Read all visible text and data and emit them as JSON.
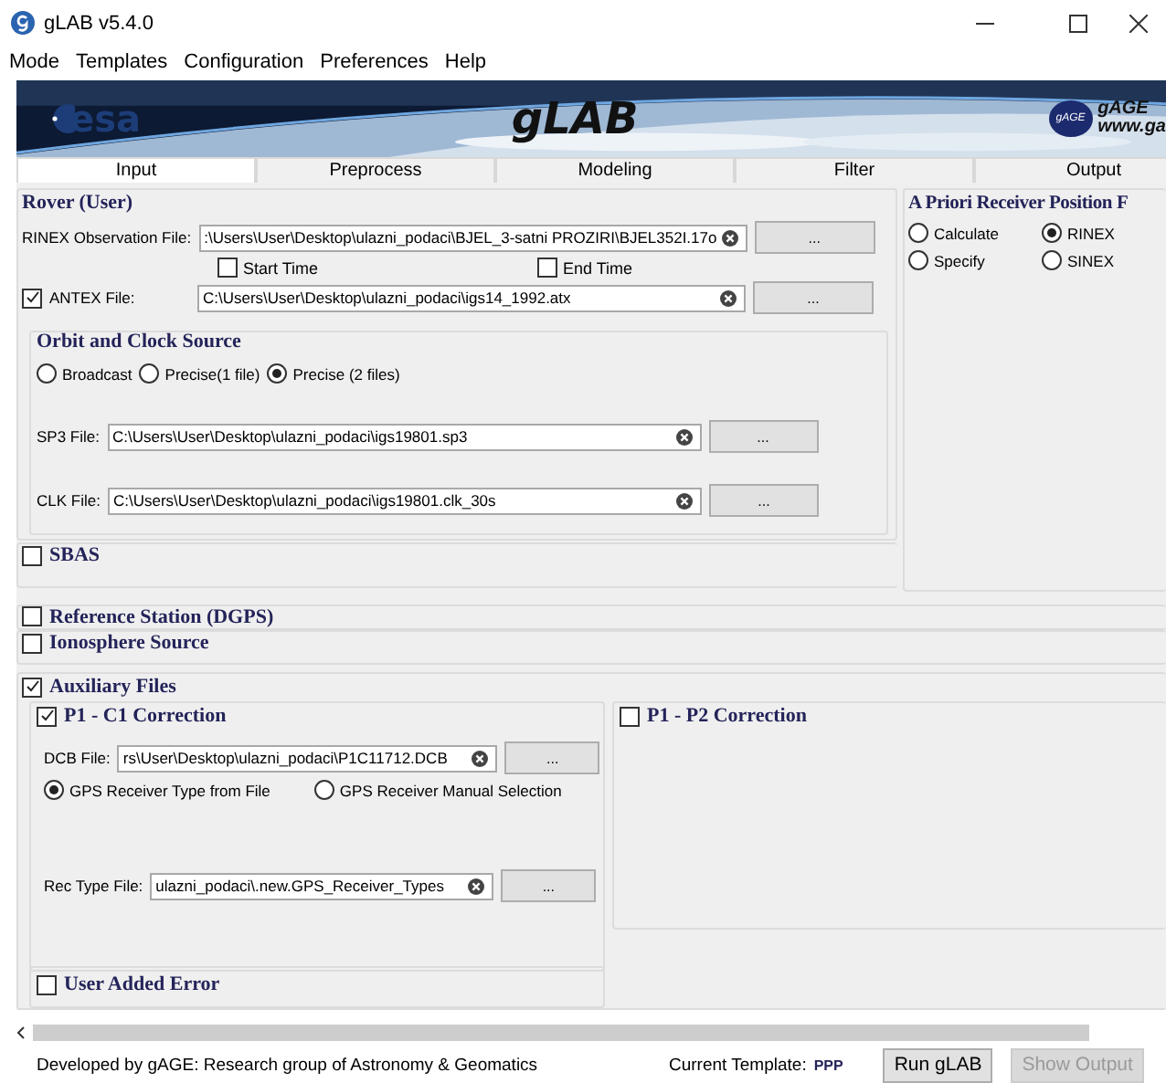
{
  "window": {
    "title": "gLAB v5.4.0"
  },
  "menu": [
    "Mode",
    "Templates",
    "Configuration",
    "Preferences",
    "Help"
  ],
  "banner": {
    "left_logo": "esa",
    "title": "gLAB",
    "right_badge": "gAGE",
    "right_title": "gAGE",
    "right_url": "www.ga"
  },
  "tabs": [
    {
      "label": "Input",
      "selected": true
    },
    {
      "label": "Preprocess",
      "selected": false
    },
    {
      "label": "Modeling",
      "selected": false
    },
    {
      "label": "Filter",
      "selected": false
    },
    {
      "label": "Output",
      "selected": false
    }
  ],
  "rover": {
    "title": "Rover (User)",
    "rinex": {
      "label": "RINEX Observation File:",
      "value": ":\\Users\\User\\Desktop\\ulazni_podaci\\BJEL_3-satni PROZIRI\\BJEL352I.17o",
      "button": "..."
    },
    "time_options": [
      {
        "label": "Start Time",
        "checked": false
      },
      {
        "label": "End Time",
        "checked": false
      }
    ],
    "antex": {
      "label": "ANTEX File:",
      "checked": true,
      "value": "C:\\Users\\User\\Desktop\\ulazni_podaci\\igs14_1992.atx",
      "button": "..."
    },
    "orbit": {
      "title": "Orbit and Clock Source",
      "options": [
        {
          "label": "Broadcast",
          "selected": false
        },
        {
          "label": "Precise(1 file)",
          "selected": false
        },
        {
          "label": "Precise (2 files)",
          "selected": true
        }
      ],
      "files": [
        {
          "label": "SP3 File:",
          "value": "C:\\Users\\User\\Desktop\\ulazni_podaci\\igs19801.sp3",
          "button": "..."
        },
        {
          "label": "CLK File:",
          "value": "C:\\Users\\User\\Desktop\\ulazni_podaci\\igs19801.clk_30s",
          "button": "..."
        }
      ]
    }
  },
  "apriori": {
    "title": "A Priori Receiver Position F",
    "options": [
      {
        "label": "Calculate",
        "selected": false
      },
      {
        "label": "RINEX",
        "selected": true
      },
      {
        "label": "Specify",
        "selected": false
      },
      {
        "label": "SINEX",
        "selected": false
      }
    ]
  },
  "sbas": {
    "title": "SBAS",
    "checked": false
  },
  "sections": [
    {
      "title": "Reference Station (DGPS)",
      "checked": false
    },
    {
      "title": "Ionosphere Source",
      "checked": false
    }
  ],
  "auxiliary": {
    "title": "Auxiliary Files",
    "checked": true,
    "p1c1": {
      "title": "P1 - C1 Correction",
      "checked": true,
      "dcb": {
        "label": "DCB File:",
        "value": "rs\\User\\Desktop\\ulazni_podaci\\P1C11712.DCB",
        "button": "..."
      },
      "receiver_options": [
        {
          "label": "GPS Receiver Type from File",
          "selected": true
        },
        {
          "label": "GPS Receiver Manual Selection",
          "selected": false
        }
      ],
      "rec_type": {
        "label": "Rec Type File:",
        "value": "ulazni_podaci\\.new.GPS_Receiver_Types",
        "button": "..."
      }
    },
    "p1p2": {
      "title": "P1 - P2 Correction",
      "checked": false
    },
    "user_error": {
      "title": "User Added Error",
      "checked": false
    }
  },
  "status_bar": {
    "credit": "Developed by gAGE: Research group of Astronomy & Geomatics",
    "template_label": "Current Template:",
    "template": "PPP",
    "buttons": [
      {
        "label": "Run gLAB",
        "disabled": false
      },
      {
        "label": "Show Output",
        "disabled": true
      }
    ]
  }
}
